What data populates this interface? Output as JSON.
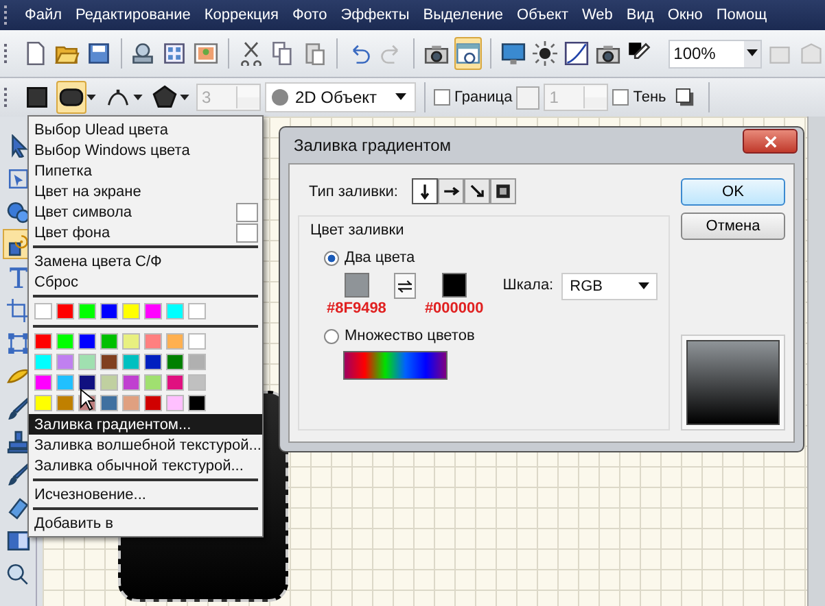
{
  "menubar": {
    "items": [
      "Файл",
      "Редактирование",
      "Коррекция",
      "Фото",
      "Эффекты",
      "Выделение",
      "Объект",
      "Web",
      "Вид",
      "Окно",
      "Помощ"
    ]
  },
  "toolbar": {
    "items": [
      {
        "kind": "new",
        "selected": false
      },
      {
        "kind": "open",
        "selected": false
      },
      {
        "kind": "save",
        "selected": false
      },
      {
        "kind": "sep"
      },
      {
        "kind": "scan",
        "selected": false
      },
      {
        "kind": "grid",
        "selected": false
      },
      {
        "kind": "photo",
        "selected": false
      },
      {
        "kind": "sep"
      },
      {
        "kind": "cut",
        "selected": false
      },
      {
        "kind": "copy",
        "selected": false
      },
      {
        "kind": "paste",
        "selected": false
      },
      {
        "kind": "sep"
      },
      {
        "kind": "undo",
        "selected": false
      },
      {
        "kind": "redo",
        "selected": false
      },
      {
        "kind": "sep"
      },
      {
        "kind": "camera",
        "selected": false
      },
      {
        "kind": "web",
        "selected": true
      },
      {
        "kind": "sep"
      },
      {
        "kind": "screen",
        "selected": false
      },
      {
        "kind": "sun",
        "selected": false
      },
      {
        "kind": "curve",
        "selected": false
      },
      {
        "kind": "camera",
        "selected": false
      },
      {
        "kind": "picker",
        "selected": false
      }
    ],
    "zoom": {
      "value": "100%"
    },
    "trailing": [
      {
        "kind": "export"
      },
      {
        "kind": "send"
      }
    ]
  },
  "property_bar": {
    "shape_buttons": [
      {
        "kind": "square",
        "selected": false
      },
      {
        "kind": "rounded",
        "selected": true
      },
      {
        "kind": "path",
        "selected": false
      },
      {
        "kind": "polygon",
        "selected": false
      }
    ],
    "width_spinner": {
      "value": "3",
      "disabled": true
    },
    "object_type": {
      "value": "2D Объект"
    },
    "border": {
      "label": "Граница",
      "checked": false
    },
    "border_width": {
      "value": "1",
      "disabled": true
    },
    "shadow": {
      "label": "Тень",
      "checked": false
    }
  },
  "tools": [
    {
      "kind": "arrow",
      "selected": false
    },
    {
      "kind": "select",
      "selected": false
    },
    {
      "kind": "bubble",
      "selected": false
    },
    {
      "kind": "fill",
      "selected": true
    },
    {
      "kind": "text",
      "selected": false
    },
    {
      "kind": "crop",
      "selected": false
    },
    {
      "kind": "transform",
      "selected": false
    },
    {
      "kind": "pen",
      "selected": false
    },
    {
      "kind": "brush",
      "selected": false
    },
    {
      "kind": "stamp",
      "selected": false
    },
    {
      "kind": "brush",
      "selected": false
    },
    {
      "kind": "eraser",
      "selected": false
    },
    {
      "kind": "gradient",
      "selected": false
    },
    {
      "kind": "zoom",
      "selected": false
    }
  ],
  "color_menu": {
    "items": [
      {
        "kind": "item",
        "label": "Выбор Ulead цвета",
        "selected": false
      },
      {
        "kind": "item",
        "label": "Выбор  Windows цвета",
        "selected": false
      },
      {
        "kind": "item",
        "label": "Пипетка",
        "selected": false
      },
      {
        "kind": "item",
        "label": "Цвет на экране",
        "selected": false
      },
      {
        "kind": "swatch_item",
        "label": "Цвет символа",
        "color": "#ffffff",
        "selected": false
      },
      {
        "kind": "swatch_item",
        "label": "Цвет фона",
        "color": "#ffffff",
        "selected": false
      },
      {
        "kind": "separator"
      },
      {
        "kind": "item",
        "label": "Замена цвета С/Ф",
        "selected": false
      },
      {
        "kind": "item",
        "label": "Сброс",
        "selected": false
      },
      {
        "kind": "separator"
      },
      {
        "kind": "palette",
        "rows": [
          [
            {
              "color": "#ffffff"
            },
            {
              "color": "#ff0000"
            },
            {
              "color": "#00ff00"
            },
            {
              "color": "#0000ff"
            },
            {
              "color": "#ffff00"
            },
            {
              "color": "#ff00ff"
            },
            {
              "color": "#00ffff"
            },
            {
              "color": "#ffffff"
            }
          ]
        ]
      },
      {
        "kind": "separator"
      },
      {
        "kind": "palette",
        "rows": [
          [
            {
              "color": "#ff0000"
            },
            {
              "color": "#00ff00"
            },
            {
              "color": "#0000ff"
            },
            {
              "color": "#00c000"
            },
            {
              "color": "#e8f080"
            },
            {
              "color": "#ff8080"
            },
            {
              "color": "#ffb050"
            },
            {
              "color": "#ffffff"
            }
          ],
          [
            {
              "color": "#00ffff"
            },
            {
              "color": "#c080f0"
            },
            {
              "color": "#a0e0b0"
            },
            {
              "color": "#804020"
            },
            {
              "color": "#00c0c0"
            },
            {
              "color": "#0020c0"
            },
            {
              "color": "#008000"
            },
            {
              "color": "#b0b0b0"
            }
          ],
          [
            {
              "color": "#ff00ff"
            },
            {
              "color": "#20c0ff"
            },
            {
              "color": "#101080"
            },
            {
              "color": "#c0d0a0"
            },
            {
              "color": "#c040d0"
            },
            {
              "color": "#a0e070"
            },
            {
              "color": "#e01080"
            },
            {
              "color": "#c0c0c0"
            }
          ],
          [
            {
              "color": "#ffff00"
            },
            {
              "color": "#c08000"
            },
            {
              "color": "#c08080"
            },
            {
              "color": "#4070a0"
            },
            {
              "color": "#e0a080"
            },
            {
              "color": "#d00000"
            },
            {
              "color": "#ffc0ff"
            },
            {
              "color": "#000000"
            }
          ]
        ]
      },
      {
        "kind": "item",
        "label": "Заливка градиентом...",
        "selected": true
      },
      {
        "kind": "item",
        "label": "Заливка волшебной текстурой...",
        "selected": false
      },
      {
        "kind": "item",
        "label": "Заливка обычной текстурой...",
        "selected": false
      },
      {
        "kind": "separator"
      },
      {
        "kind": "item",
        "label": "Исчезновение...",
        "selected": false
      },
      {
        "kind": "separator"
      },
      {
        "kind": "item",
        "label": "Добавить в",
        "selected": false
      }
    ]
  },
  "dialog": {
    "title": "Заливка градиентом",
    "fill_type": {
      "label": "Тип заливки:",
      "options": [
        {
          "kind": "down",
          "selected": true
        },
        {
          "kind": "right",
          "selected": false
        },
        {
          "kind": "diagonal",
          "selected": false
        },
        {
          "kind": "radial",
          "selected": false
        }
      ]
    },
    "group": {
      "title": "Цвет заливки",
      "two_colors": {
        "label": "Два цвета",
        "selected": true
      },
      "from": {
        "color": "#8f9498",
        "code": "#8F9498"
      },
      "to": {
        "color": "#000000",
        "code": "#000000"
      },
      "scale": {
        "label": "Шкала:",
        "value": "RGB"
      },
      "multi": {
        "label": "Множество цветов",
        "selected": false
      }
    },
    "buttons": [
      "OK",
      "Отмена"
    ]
  }
}
